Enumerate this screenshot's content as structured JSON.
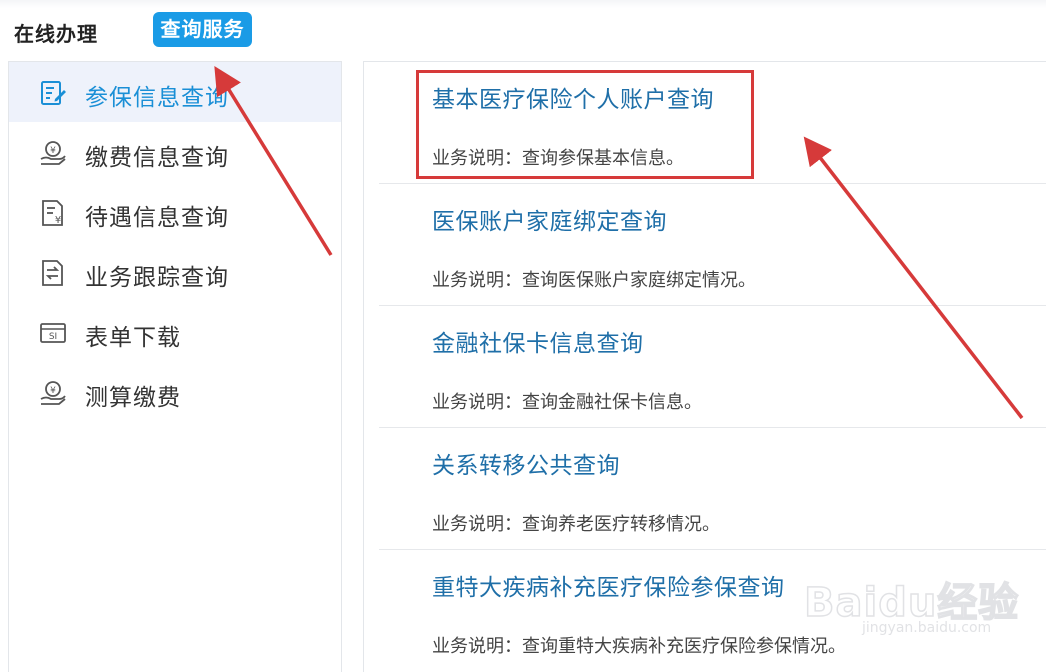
{
  "header": {
    "tab_online": "在线办理",
    "tab_query": "查询服务"
  },
  "sidebar": {
    "items": [
      {
        "label": "参保信息查询",
        "icon": "form-edit-icon",
        "active": true
      },
      {
        "label": "缴费信息查询",
        "icon": "hand-coin-icon",
        "active": false
      },
      {
        "label": "待遇信息查询",
        "icon": "document-yen-icon",
        "active": false
      },
      {
        "label": "业务跟踪查询",
        "icon": "transfer-arrows-icon",
        "active": false
      },
      {
        "label": "表单下载",
        "icon": "si-card-icon",
        "active": false
      },
      {
        "label": "测算缴费",
        "icon": "hand-coin-icon",
        "active": false
      }
    ]
  },
  "services": [
    {
      "title": "基本医疗保险个人账户查询",
      "desc": "业务说明：查询参保基本信息。"
    },
    {
      "title": "医保账户家庭绑定查询",
      "desc": "业务说明：查询医保账户家庭绑定情况。"
    },
    {
      "title": "金融社保卡信息查询",
      "desc": "业务说明：查询金融社保卡信息。"
    },
    {
      "title": "关系转移公共查询",
      "desc": "业务说明：查询养老医疗转移情况。"
    },
    {
      "title": "重特大疾病补充医疗保险参保查询",
      "desc": "业务说明：查询重特大疾病补充医疗保险参保情况。"
    }
  ],
  "annotation": {
    "color": "#d63a3a"
  },
  "watermark": {
    "brand": "Baidu经验",
    "url": "jingyan.baidu.com"
  },
  "colors": {
    "accent": "#1a9be6",
    "active_text": "#1a8fd6",
    "link_title": "#1f6fa8"
  }
}
